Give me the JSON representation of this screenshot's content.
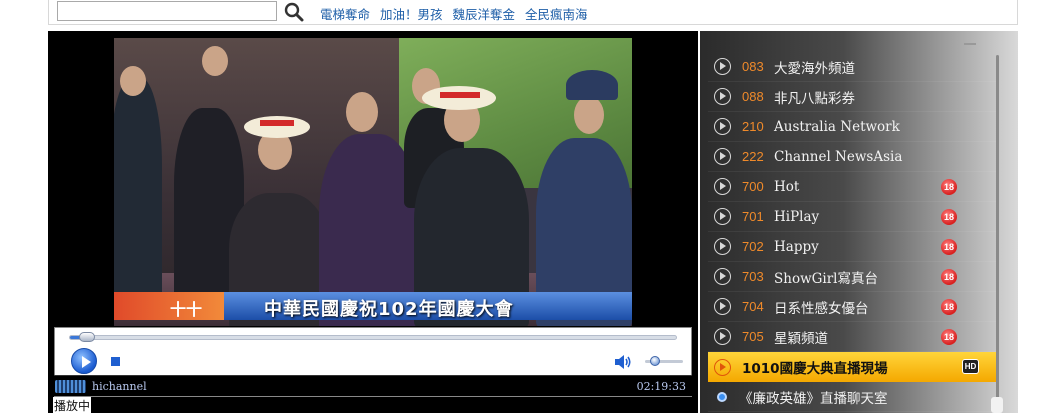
{
  "search": {
    "value": "",
    "placeholder": ""
  },
  "hot_links": [
    "電梯奪命",
    "加油！男孩",
    "魏辰洋奪金",
    "全民瘋南海"
  ],
  "video": {
    "caption": "中華民國慶祝102年國慶大會",
    "caption_logo": "十十"
  },
  "player": {
    "progress": 0.02,
    "volume": 0.12,
    "channel_name": "hichannel",
    "time": "02:19:33",
    "state": "播放中"
  },
  "channels": [
    {
      "number": "083",
      "name": "大愛海外頻道",
      "age_badge": ""
    },
    {
      "number": "088",
      "name": "非凡八點彩券",
      "age_badge": ""
    },
    {
      "number": "210",
      "name": "Australia Network",
      "age_badge": ""
    },
    {
      "number": "222",
      "name": "Channel NewsAsia",
      "age_badge": ""
    },
    {
      "number": "700",
      "name": "Hot",
      "age_badge": "18"
    },
    {
      "number": "701",
      "name": "HiPlay",
      "age_badge": "18"
    },
    {
      "number": "702",
      "name": "Happy",
      "age_badge": "18"
    },
    {
      "number": "703",
      "name": "ShowGirl寫真台",
      "age_badge": "18"
    },
    {
      "number": "704",
      "name": "日系性感女優台",
      "age_badge": "18"
    },
    {
      "number": "705",
      "name": "星穎頻道",
      "age_badge": "18"
    }
  ],
  "active_channel": {
    "name": "1010國慶大典直播現場",
    "badge": "HD"
  },
  "live_channel": {
    "name": "《廉政英雄》直播聊天室"
  },
  "colors": {
    "link": "#1f5fa8",
    "channel_number": "#f08a2a",
    "active_row": "#f4a800",
    "age_badge": "#d8201f"
  }
}
